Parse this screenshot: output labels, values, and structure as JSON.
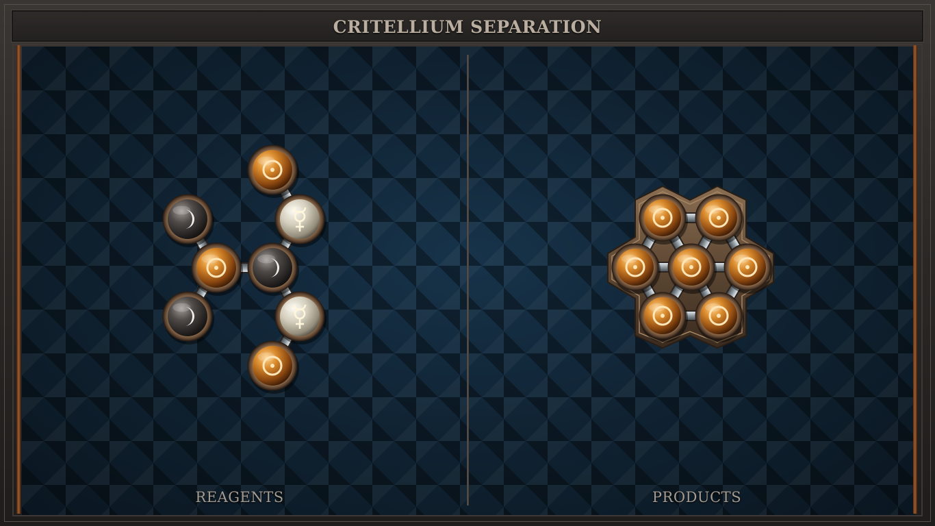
{
  "title": "CRITELLIUM SEPARATION",
  "panels": {
    "reagents_label": "REAGENTS",
    "products_label": "PRODUCTS"
  },
  "reagent_molecule": {
    "atoms": [
      {
        "element": "gold",
        "symbol": "sun"
      },
      {
        "element": "quicksilver",
        "symbol": "mercury"
      },
      {
        "element": "silver",
        "symbol": "moon"
      },
      {
        "element": "gold",
        "symbol": "sun"
      },
      {
        "element": "silver",
        "symbol": "moon"
      },
      {
        "element": "silver",
        "symbol": "moon"
      },
      {
        "element": "quicksilver",
        "symbol": "mercury"
      },
      {
        "element": "gold",
        "symbol": "sun"
      }
    ]
  },
  "product_molecule": {
    "atoms": [
      {
        "element": "gold",
        "symbol": "sun"
      },
      {
        "element": "gold",
        "symbol": "sun"
      },
      {
        "element": "gold",
        "symbol": "sun"
      },
      {
        "element": "gold",
        "symbol": "sun"
      },
      {
        "element": "gold",
        "symbol": "sun"
      },
      {
        "element": "gold",
        "symbol": "sun"
      },
      {
        "element": "gold",
        "symbol": "sun"
      }
    ]
  },
  "colors": {
    "gold": "#b8661a",
    "silver": "#4a4644",
    "quicksilver": "#d6d2c2",
    "bond": "#a8b2b8",
    "title": "#b9aea0",
    "background": "#10202e"
  }
}
